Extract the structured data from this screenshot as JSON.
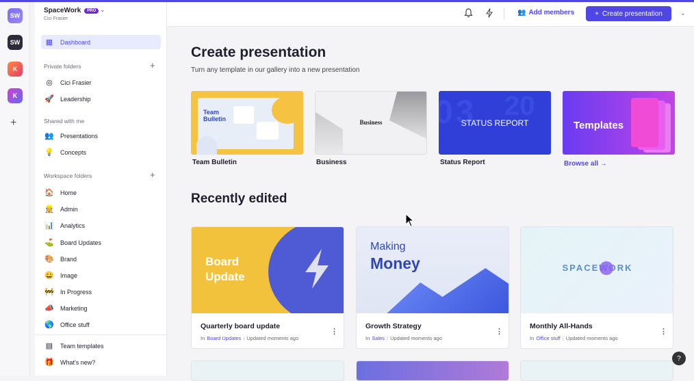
{
  "workspace": {
    "name": "SpaceWork",
    "badge": "PRO",
    "user": "Cici Frasier"
  },
  "rail": {
    "items": [
      "SW",
      "SW",
      "K",
      "K"
    ],
    "add": "+"
  },
  "sidebar": {
    "dashboard": "Dashboard",
    "private_label": "Private folders",
    "private_items": [
      {
        "label": "Cici Frasier",
        "icon": "user-icon"
      },
      {
        "label": "Leadership",
        "icon": "rocket-icon"
      }
    ],
    "shared_label": "Shared with me",
    "shared_items": [
      {
        "label": "Presentations",
        "icon": "people-icon"
      },
      {
        "label": "Concepts",
        "icon": "lightbulb-icon"
      }
    ],
    "workspace_label": "Workspace folders",
    "workspace_items": [
      {
        "label": "Home",
        "icon": "house-icon"
      },
      {
        "label": "Admin",
        "icon": "admin-icon"
      },
      {
        "label": "Analytics",
        "icon": "bar-chart-icon"
      },
      {
        "label": "Board Updates",
        "icon": "golf-icon"
      },
      {
        "label": "Brand",
        "icon": "palette-icon"
      },
      {
        "label": "Image",
        "icon": "smiley-icon"
      },
      {
        "label": "In Progress",
        "icon": "construction-icon"
      },
      {
        "label": "Marketing",
        "icon": "megaphone-icon"
      },
      {
        "label": "Office stuff",
        "icon": "globe-icon"
      }
    ],
    "footer_items": [
      {
        "label": "Team templates",
        "icon": "template-icon"
      },
      {
        "label": "What's new?",
        "icon": "gift-icon"
      }
    ]
  },
  "header": {
    "add_members": "Add members",
    "create": "Create presentation"
  },
  "main": {
    "create_title": "Create presentation",
    "create_subtitle": "Turn any template in our gallery into a new presentation",
    "templates": [
      {
        "label": "Team Bulletin",
        "thumb_text": "Team Bulletin"
      },
      {
        "label": "Business",
        "thumb_text": "Business"
      },
      {
        "label": "Status Report",
        "thumb_text": "STATUS REPORT"
      },
      {
        "label": "",
        "thumb_text": "Templates"
      }
    ],
    "browse_all": "Browse all →",
    "recent_title": "Recently edited",
    "recent": [
      {
        "title": "Quarterly board update",
        "prefix": "In",
        "folder": "Board Updates",
        "updated": "Updated moments ago",
        "thumb_text": "Board Update"
      },
      {
        "title": "Growth Strategy",
        "prefix": "In",
        "folder": "Sales",
        "updated": "Updated moments ago",
        "thumb_line1": "Making",
        "thumb_line2": "Money"
      },
      {
        "title": "Monthly All-Hands",
        "prefix": "In",
        "folder": "Office stuff",
        "updated": "Updated moments ago",
        "thumb_text": "SPACEWORK"
      }
    ]
  },
  "colors": {
    "accent": "#4f46e5",
    "pro": "#6d28d9"
  }
}
